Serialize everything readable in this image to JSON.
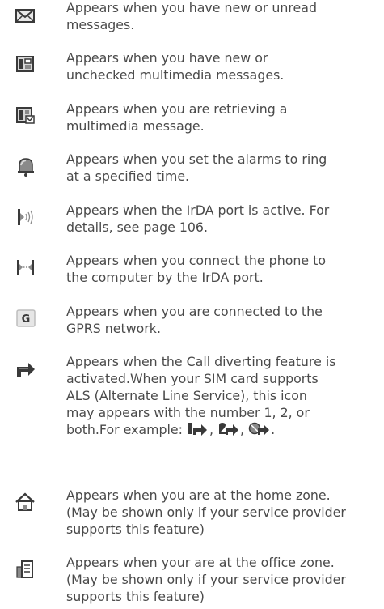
{
  "items": [
    {
      "icon": "envelope-icon",
      "lines": [
        "Appears when you have new or unread",
        "messages."
      ]
    },
    {
      "icon": "multimedia-message-icon",
      "lines": [
        "Appears when you have new or",
        "unchecked multimedia messages."
      ]
    },
    {
      "icon": "retrieving-multimedia-icon",
      "lines": [
        "Appears when you are retrieving a",
        "multimedia message."
      ]
    },
    {
      "icon": "alarm-bell-icon",
      "lines": [
        "Appears when you set the alarms to ring",
        "at a specified time."
      ]
    },
    {
      "icon": "irda-active-icon",
      "lines": [
        "Appears when the IrDA port is active. For",
        "details, see page 106."
      ]
    },
    {
      "icon": "irda-connected-icon",
      "lines": [
        "Appears when you connect the phone to",
        "the computer by the IrDA port."
      ]
    },
    {
      "icon": "gprs-icon",
      "lines": [
        "Appears when you are connected to the",
        "GPRS network."
      ]
    },
    {
      "icon": "call-divert-icon",
      "lines": [
        "Appears when the Call diverting feature is",
        "activated.When your SIM card supports",
        "ALS (Alternate Line Service), this icon",
        "may appears with the number 1, 2, or",
        "both.For example:"
      ],
      "separators": [
        ",",
        ",",
        "."
      ]
    },
    {
      "icon": "home-zone-icon",
      "lines": [
        "Appears when you are at the home zone.",
        "(May be shown only if your service provider",
        "supports this feature)"
      ]
    },
    {
      "icon": "office-zone-icon",
      "lines": [
        "Appears when your are at the office zone.",
        "(May be shown only if your service provider",
        "supports this feature)"
      ]
    }
  ],
  "gprs_letter": "G",
  "colors": {
    "text": "#4a4a4a",
    "icon_dark": "#3a3a3a",
    "icon_mid": "#8a8a8a",
    "icon_light": "#d8d8d8"
  }
}
